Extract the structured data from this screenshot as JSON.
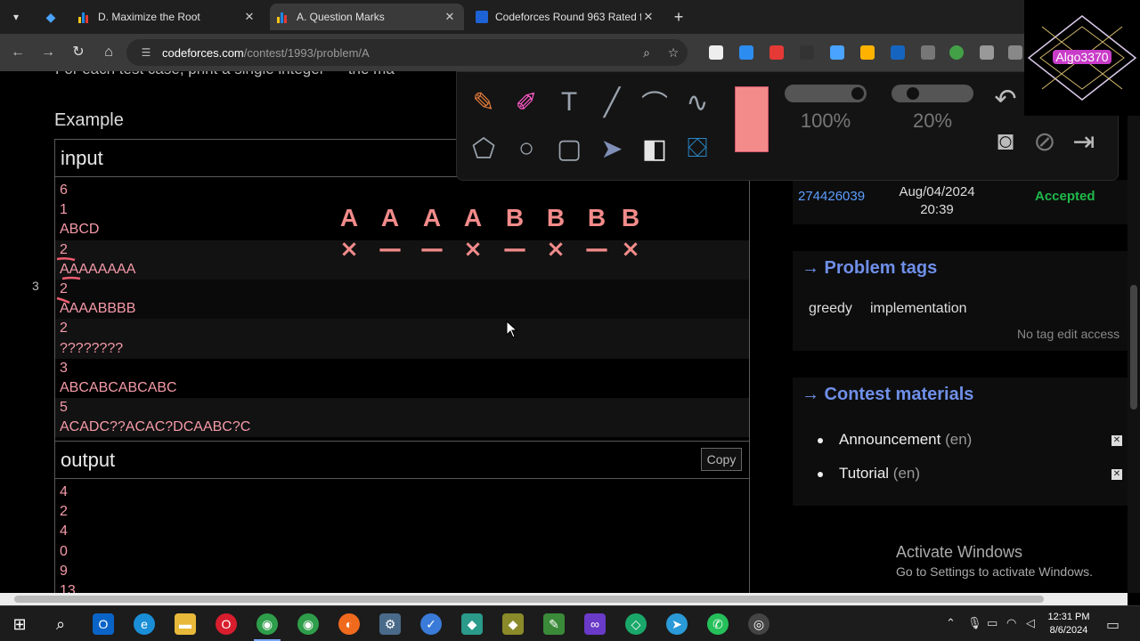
{
  "tabs": [
    {
      "title": "D. Maximize the Root",
      "active": false
    },
    {
      "title": "A. Question Marks",
      "active": true
    },
    {
      "title": "Codeforces Round 963 Rated fo",
      "active": false
    }
  ],
  "address": {
    "host": "codeforces.com",
    "path": "/contest/1993/problem/A"
  },
  "page": {
    "cut_text": "For each test case, print a single integer — the ma",
    "example_heading": "Example",
    "line_number": "3",
    "input": {
      "label": "input",
      "lines": [
        "6",
        "1",
        "ABCD",
        "2",
        "AAAAAAAA",
        "2",
        "AAAABBBB",
        "2",
        "????????",
        "3",
        "ABCABCABCABC",
        "5",
        "ACADC??ACAC?DCAABC?C"
      ]
    },
    "output": {
      "label": "output",
      "copy_label": "Copy",
      "lines": [
        "4",
        "2",
        "4",
        "0",
        "9",
        "13"
      ]
    }
  },
  "annotation": {
    "letters": [
      "A",
      "A",
      "A",
      "A",
      "B",
      "B",
      "B",
      "B"
    ],
    "marks": [
      "×",
      "—",
      "—",
      "×",
      "—",
      "×",
      "—",
      "×"
    ]
  },
  "submission": {
    "id": "274426039",
    "date": "Aug/04/2024",
    "time": "20:39",
    "verdict": "Accepted"
  },
  "problem_tags": {
    "title": "→ Problem tags",
    "tags": [
      "greedy",
      "implementation"
    ],
    "no_edit": "No tag edit access"
  },
  "contest_materials": {
    "title": "→ Contest materials",
    "items": [
      {
        "label": "Announcement",
        "lang": "(en)"
      },
      {
        "label": "Tutorial",
        "lang": "(en)"
      }
    ]
  },
  "draw_toolbar": {
    "size_label": "100%",
    "opacity_label": "20%",
    "swatch_color": "#f38b8b",
    "size_fraction": 1.0,
    "opacity_fraction": 0.2
  },
  "logo": {
    "text": "Algo3370"
  },
  "watermark": {
    "line1": "Activate Windows",
    "line2": "Go to Settings to activate Windows."
  },
  "clock": {
    "time": "12:31 PM",
    "date": "8/6/2024"
  },
  "colors": {
    "accent_link": "#5c9eff",
    "verdict_ok": "#1fb84a",
    "ink": "#f38b8b",
    "section_title": "#6f8fe8"
  }
}
